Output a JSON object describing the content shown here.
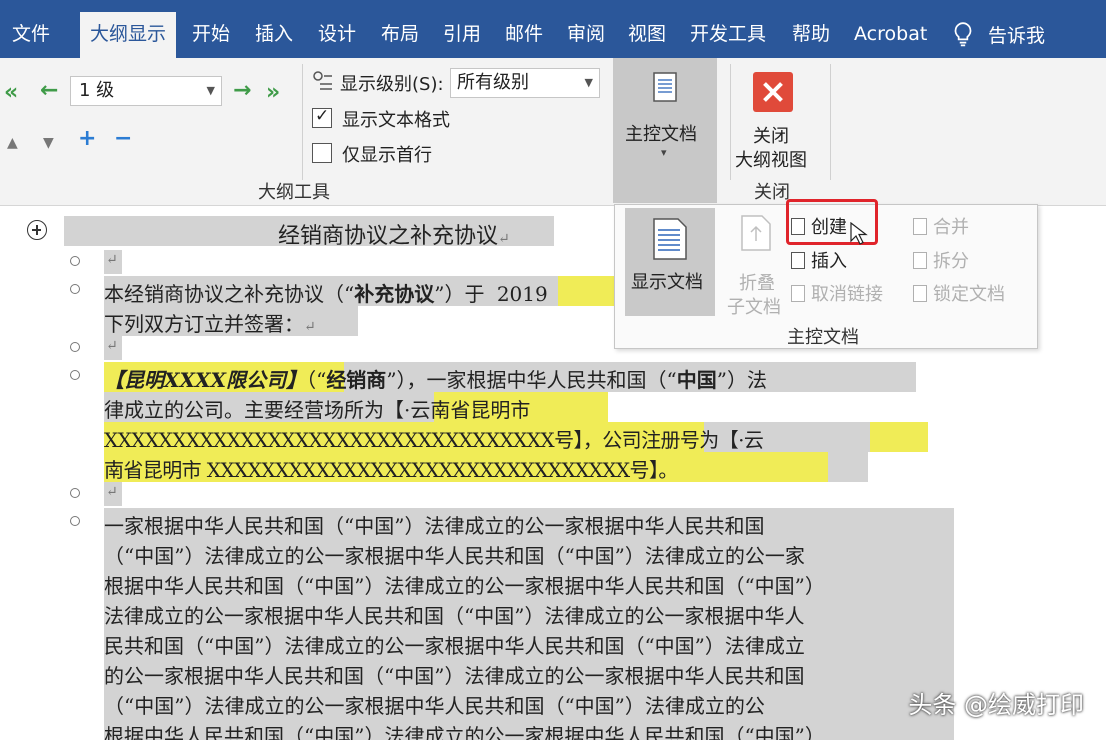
{
  "tabs": [
    "文件",
    "大纲显示",
    "开始",
    "插入",
    "设计",
    "布局",
    "引用",
    "邮件",
    "审阅",
    "视图",
    "开发工具",
    "帮助",
    "Acrobat"
  ],
  "tell_me": "告诉我",
  "outline_tools": {
    "level_value": "1 级",
    "show_level_label": "显示级别(S):",
    "show_level_value": "所有级别",
    "show_text_format": "显示文本格式",
    "show_first_line_only": "仅显示首行",
    "group_label": "大纲工具"
  },
  "master_document": {
    "label": "主控文档"
  },
  "close_group": {
    "button_label_1": "关闭",
    "button_label_2": "大纲视图",
    "group_label": "关闭"
  },
  "dropdown": {
    "show_document": "显示文档",
    "collapse_1": "折叠",
    "collapse_2": "子文档",
    "create": "创建",
    "insert": "插入",
    "unlink": "取消链接",
    "merge": "合并",
    "split": "拆分",
    "lock": "锁定文档",
    "group_label": "主控文档"
  },
  "document": {
    "title": "经销商协议之补充协议",
    "p1_a": "本经销商协议之补充协议（“",
    "p1_b": "补充协议",
    "p1_c": "”）于",
    "p1_year": "2019",
    "p1_line2": "下列双方订立并签署：",
    "p2_company": "【昆明XXXX限公司】",
    "p2_rest_a": "（“",
    "p2_rest_b": "经销商",
    "p2_rest_c": "”），一家根据中华人民共和国（“",
    "p2_rest_d": "中国",
    "p2_rest_e": "”）法",
    "p2_l2_a": "律成立的公司。主要经营场所为",
    "p2_l2_b": "【·云南省昆明市",
    "p2_l3_a": "XXXXXXXXXXXXXXXXXXXXXXXXXXXXXXXXX号】",
    "p2_l3_b": "，公司注册号为",
    "p2_l3_c": "【·云",
    "p2_l4_a": "南省昆明市 XXXXXXXXXXXXXXXXXXXXXXXXXXXXXXX号】",
    "p2_l4_b": "。",
    "body_lines": [
      "一家根据中华人民共和国（“中国”）法律成立的公一家根据中华人民共和国",
      "（“中国”）法律成立的公一家根据中华人民共和国（“中国”）法律成立的公一家",
      "根据中华人民共和国（“中国”）法律成立的公一家根据中华人民共和国（“中国”）",
      "法律成立的公一家根据中华人民共和国（“中国”）法律成立的公一家根据中华人",
      "民共和国（“中国”）法律成立的公一家根据中华人民共和国（“中国”）法律成立",
      "的公一家根据中华人民共和国（“中国”）法律成立的公一家根据中华人民共和国",
      "（“中国”）法律成立的公一家根据中华人民共和国（“中国”）法律成立的公",
      "根据中华人民共和国（“中国”）法律成立的公一家根据中华人民共和国（“中国”）"
    ]
  },
  "watermark": "头条 @绘威打印"
}
